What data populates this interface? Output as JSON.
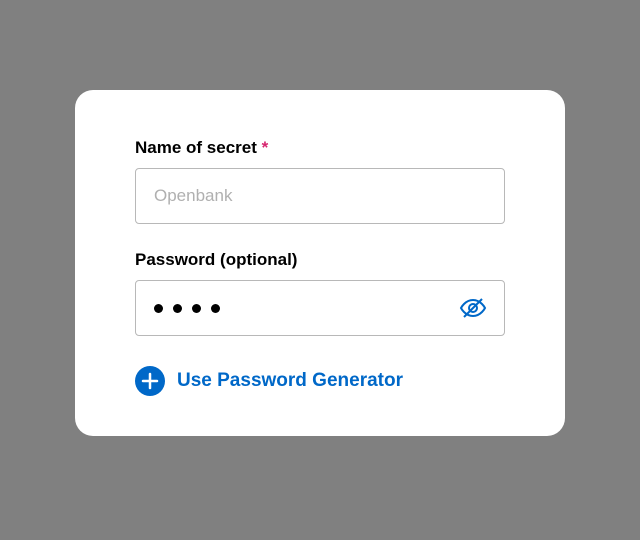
{
  "form": {
    "name": {
      "label": "Name of secret",
      "required_mark": "*",
      "placeholder": "Openbank",
      "value": ""
    },
    "password": {
      "label": "Password (optional)",
      "masked_value": "••••",
      "dot_count": 4
    },
    "generator": {
      "label": "Use Password Generator"
    }
  },
  "colors": {
    "accent": "#0068c8",
    "required": "#d6246e",
    "card_bg": "#ffffff",
    "page_bg": "#808080",
    "border": "#b8b8b8",
    "placeholder": "#b0b0b0"
  }
}
